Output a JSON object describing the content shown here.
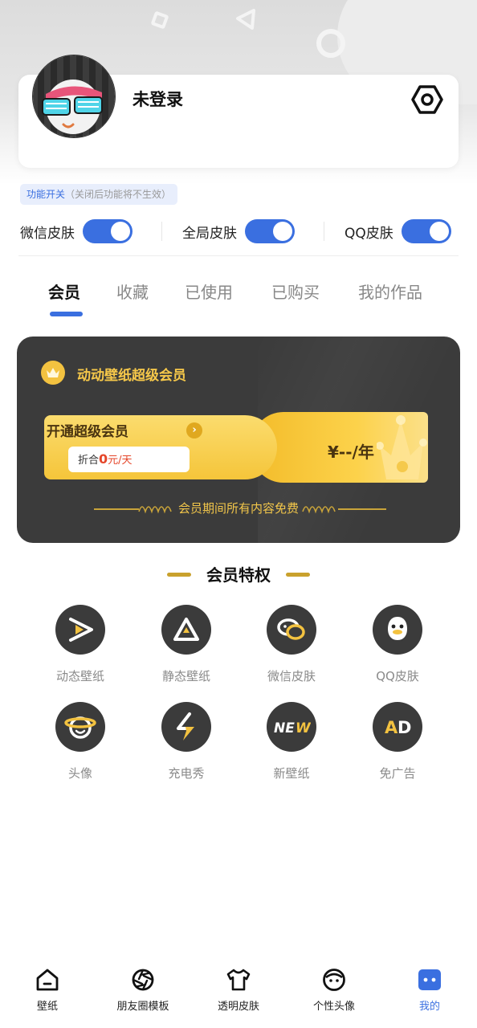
{
  "profile": {
    "login_status": "未登录"
  },
  "function_switch": {
    "tag": "功能开关",
    "note": "（关闭后功能将不生效）",
    "toggles": [
      {
        "label": "微信皮肤",
        "on": true
      },
      {
        "label": "全局皮肤",
        "on": true
      },
      {
        "label": "QQ皮肤",
        "on": true
      }
    ]
  },
  "tabs": [
    {
      "label": "会员",
      "active": true
    },
    {
      "label": "收藏",
      "active": false
    },
    {
      "label": "已使用",
      "active": false
    },
    {
      "label": "已购买",
      "active": false
    },
    {
      "label": "我的作品",
      "active": false
    }
  ],
  "vip": {
    "title": "动动壁纸超级会员",
    "open_label": "开通超级会员",
    "discount_prefix": "折合",
    "discount_value": "0",
    "discount_unit": "元/天",
    "price": "¥--/年",
    "footer": "会员期间所有内容免费"
  },
  "privileges": {
    "title": "会员特权",
    "items": [
      {
        "label": "动态壁纸",
        "icon": "play-icon"
      },
      {
        "label": "静态壁纸",
        "icon": "triangle-icon"
      },
      {
        "label": "微信皮肤",
        "icon": "wechat-chat-icon"
      },
      {
        "label": "QQ皮肤",
        "icon": "qq-penguin-icon"
      },
      {
        "label": "头像",
        "icon": "planet-face-icon"
      },
      {
        "label": "充电秀",
        "icon": "lightning-icon"
      },
      {
        "label": "新壁纸",
        "icon": "new-badge-icon"
      },
      {
        "label": "免广告",
        "icon": "ad-free-icon"
      }
    ]
  },
  "bottom_nav": [
    {
      "label": "壁纸",
      "icon": "home-icon",
      "active": false
    },
    {
      "label": "朋友圈模板",
      "icon": "aperture-icon",
      "active": false
    },
    {
      "label": "透明皮肤",
      "icon": "tshirt-icon",
      "active": false
    },
    {
      "label": "个性头像",
      "icon": "face-icon",
      "active": false
    },
    {
      "label": "我的",
      "icon": "profile-icon",
      "active": true
    }
  ],
  "colors": {
    "accent_blue": "#3a6fe0",
    "vip_gold": "#f6c84a",
    "vip_card_bg": "#3b3b3b"
  }
}
